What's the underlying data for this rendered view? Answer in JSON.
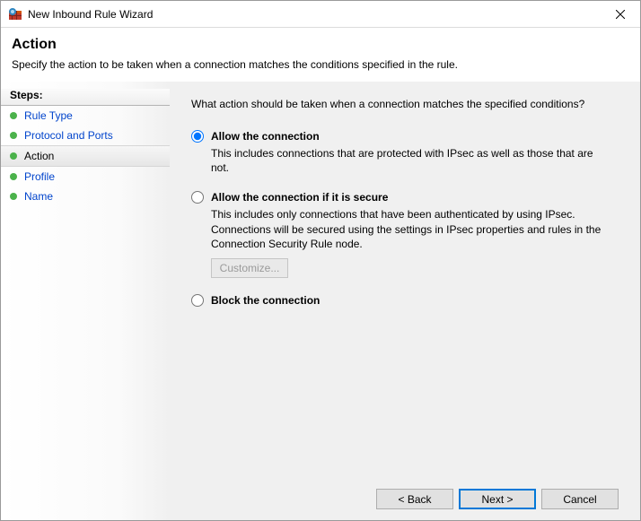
{
  "window": {
    "title": "New Inbound Rule Wizard"
  },
  "header": {
    "title": "Action",
    "description": "Specify the action to be taken when a connection matches the conditions specified in the rule."
  },
  "sidebar": {
    "header": "Steps:",
    "items": [
      {
        "label": "Rule Type",
        "current": false
      },
      {
        "label": "Protocol and Ports",
        "current": false
      },
      {
        "label": "Action",
        "current": true
      },
      {
        "label": "Profile",
        "current": false
      },
      {
        "label": "Name",
        "current": false
      }
    ]
  },
  "content": {
    "prompt": "What action should be taken when a connection matches the specified conditions?",
    "options": [
      {
        "id": "allow",
        "label": "Allow the connection",
        "description": "This includes connections that are protected with IPsec as well as those that are not.",
        "selected": true
      },
      {
        "id": "allow-secure",
        "label": "Allow the connection if it is secure",
        "description": "This includes only connections that have been authenticated by using IPsec.  Connections will be secured using the settings in IPsec properties and rules in the Connection Security Rule node.",
        "selected": false,
        "customize_label": "Customize..."
      },
      {
        "id": "block",
        "label": "Block the connection",
        "description": "",
        "selected": false
      }
    ]
  },
  "footer": {
    "back": "< Back",
    "next": "Next >",
    "cancel": "Cancel"
  }
}
